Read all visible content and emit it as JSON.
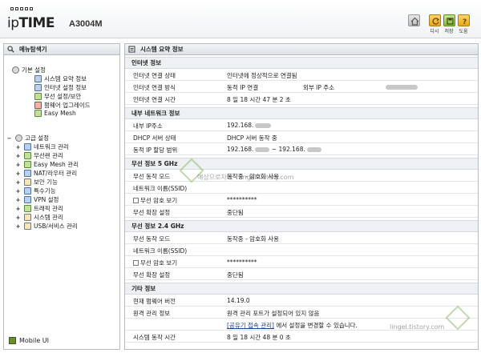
{
  "header": {
    "logo": {
      "ip": "ip",
      "time": "TIME"
    },
    "model": "A3004M",
    "buttons": [
      {
        "id": "home",
        "label": "",
        "icon": "home-icon"
      },
      {
        "id": "refresh",
        "label": "다시",
        "icon": "refresh-icon"
      },
      {
        "id": "save",
        "label": "저장",
        "icon": "save-icon"
      },
      {
        "id": "help",
        "label": "도움",
        "icon": "help-icon"
      }
    ]
  },
  "nav": {
    "title": "메뉴탐색기",
    "basic": {
      "label": "기본 설정",
      "items": [
        "시스템 요약 정보",
        "인터넷 설정 정보",
        "무선 설정/보안",
        "펌웨어 업그레이드",
        "Easy Mesh"
      ]
    },
    "advanced": {
      "label": "고급 설정",
      "items": [
        "네트워크 관리",
        "무선랜 관리",
        "Easy Mesh 관리",
        "NAT/라우터 관리",
        "보안 기능",
        "특수기능",
        "VPN 설정",
        "트래픽 관리",
        "시스템 관리",
        "USB/서비스 관리"
      ]
    },
    "mobile": "Mobile UI"
  },
  "main": {
    "title": "시스템 요약 정보",
    "sections": {
      "internet": {
        "title": "인터넷 정보",
        "rows": [
          {
            "label": "인터넷 연결 상태",
            "value": "인터넷에 정상적으로 연결됨"
          },
          {
            "label": "인터넷 연결 방식",
            "value": "동적 IP 연결",
            "extra_label": "외부 IP 주소"
          },
          {
            "label": "인터넷 연결 시간",
            "value": "8 일 18 시간 47 분 2 초"
          }
        ]
      },
      "lan": {
        "title": "내부 네트워크 정보",
        "rows": [
          {
            "label": "내부 IP주소",
            "value": "192.168."
          },
          {
            "label": "DHCP 서버 상태",
            "value": "DHCP 서버 동작 중"
          },
          {
            "label": "동적 IP 할당 범위",
            "value": "192.168.",
            "value_end": "~ 192.168."
          }
        ]
      },
      "w5": {
        "title": "무선 정보 5 GHz",
        "rows": [
          {
            "label": "무선 동작 모드",
            "value": "동작중 - 암호화 사용"
          },
          {
            "label": "네트워크 이름(SSID)",
            "value": ""
          },
          {
            "label": "무선 암호 보기",
            "value": "**********"
          },
          {
            "label": "무선 확장 설정",
            "value": "중단됨"
          }
        ]
      },
      "w24": {
        "title": "무선 정보 2.4 GHz",
        "rows": [
          {
            "label": "무선 동작 모드",
            "value": "동작중 - 암호화 사용"
          },
          {
            "label": "네트워크 이름(SSID)",
            "value": ""
          },
          {
            "label": "무선 암호 보기",
            "value": "**********"
          },
          {
            "label": "무선 확장 설정",
            "value": "중단됨"
          }
        ]
      },
      "etc": {
        "title": "기타 정보",
        "rows": [
          {
            "label": "현재 펌웨어 버전",
            "value": "14.19.0"
          },
          {
            "label": "원격 관리 정보",
            "value": "원격 관리 포트가 설정되어 있지 않음"
          },
          {
            "label": "",
            "link": "[공유기 접속 관리]",
            "value": "에서 설정을 변경할 수 있습니다."
          },
          {
            "label": "시스템 동작 시간",
            "value": "8 일 18 시간 48 분 0 초"
          }
        ]
      }
    }
  },
  "watermark": {
    "center": "얘상으로차네 - lingel.tistory.com",
    "bottom": "lingel.tistory.com"
  }
}
